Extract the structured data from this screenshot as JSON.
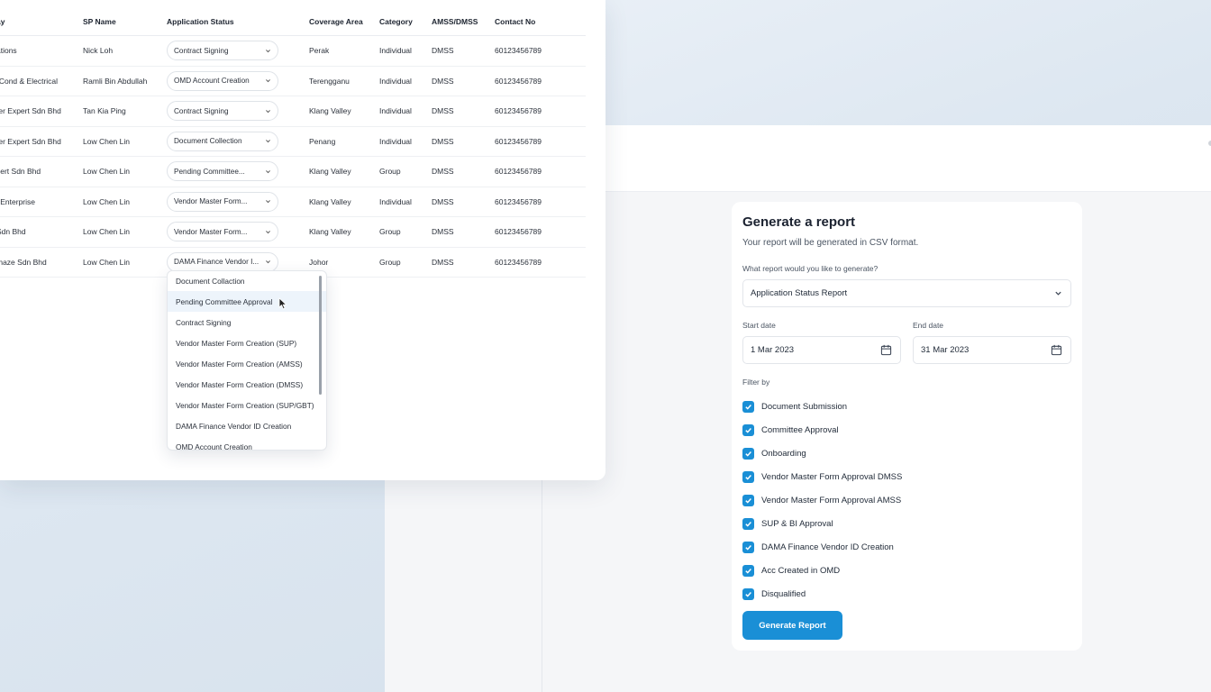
{
  "table": {
    "headers": {
      "company": "ay",
      "sp_name": "SP Name",
      "status": "Application Status",
      "area": "Coverage Area",
      "category": "Category",
      "amss": "AMSS/DMSS",
      "contact": "Contact No"
    },
    "rows": [
      {
        "company": "ations",
        "sp_name": "Nick Loh",
        "status": "Contract Signing",
        "area": "Perak",
        "category": "Individual",
        "amss": "DMSS",
        "contact": "60123456789"
      },
      {
        "company": "-Cond & Electrical",
        "sp_name": "Ramli Bin Abdullah",
        "status": "OMD Account Creation",
        "area": "Terengganu",
        "category": "Individual",
        "amss": "DMSS",
        "contact": "60123456789"
      },
      {
        "company": "ter Expert Sdn Bhd",
        "sp_name": "Tan Kia Ping",
        "status": "Contract Signing",
        "area": "Klang Valley",
        "category": "Individual",
        "amss": "DMSS",
        "contact": "60123456789"
      },
      {
        "company": "ter Expert Sdn Bhd",
        "sp_name": "Low Chen Lin",
        "status": "Document Collection",
        "area": "Penang",
        "category": "Individual",
        "amss": "DMSS",
        "contact": "60123456789"
      },
      {
        "company": "sert Sdn Bhd",
        "sp_name": "Low Chen Lin",
        "status": "Pending Committee...",
        "area": "Klang Valley",
        "category": "Group",
        "amss": "DMSS",
        "contact": "60123456789"
      },
      {
        "company": "l Enterprise",
        "sp_name": "Low Chen Lin",
        "status": "Vendor Master Form...",
        "area": "Klang Valley",
        "category": "Individual",
        "amss": "DMSS",
        "contact": "60123456789"
      },
      {
        "company": " Sdn Bhd",
        "sp_name": "Low Chen Lin",
        "status": "Vendor Master Form...",
        "area": "Klang Valley",
        "category": "Group",
        "amss": "DMSS",
        "contact": "60123456789"
      },
      {
        "company": "maze Sdn Bhd",
        "sp_name": "Low Chen Lin",
        "status": "DAMA Finance Vendor I...",
        "area": "Johor",
        "category": "Group",
        "amss": "DMSS",
        "contact": "60123456789"
      }
    ]
  },
  "status_dropdown": {
    "options": [
      "Document Collaction",
      "Pending Committee Approval",
      "Contract Signing",
      "Vendor Master Form Creation (SUP)",
      "Vendor Master Form Creation (AMSS)",
      "Vendor Master Form Creation (DMSS)",
      "Vendor Master Form Creation (SUP/GBT)",
      "DAMA Finance Vendor ID Creation",
      "OMD Account Creation"
    ],
    "highlighted_index": 1
  },
  "report": {
    "title": "Generate a report",
    "subtitle": "Your report will be generated in CSV format.",
    "question_label": "What report would you like to generate?",
    "selected_report": "Application Status Report",
    "start_label": "Start date",
    "start_value": "1 Mar 2023",
    "end_label": "End date",
    "end_value": "31 Mar 2023",
    "filter_label": "Filter by",
    "filters": [
      "Document Submission",
      "Committee Approval",
      "Onboarding",
      "Vendor Master Form Approval DMSS",
      "Vendor Master Form Approval AMSS",
      "SUP & BI Approval",
      "DAMA Finance Vendor ID Creation",
      "Acc Created in OMD",
      "Disqualified"
    ],
    "button_label": "Generate Report"
  },
  "colors": {
    "accent": "#1a8fd6",
    "highlight": "#edf4fb"
  }
}
